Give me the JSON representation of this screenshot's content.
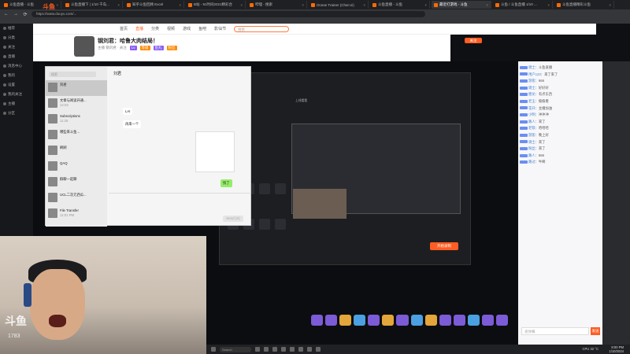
{
  "browser": {
    "tabs": [
      {
        "title": "斗鱼直播 - 斗鱼"
      },
      {
        "title": "斗鱼直播下 | 1/10 千岛..."
      },
      {
        "title": "知乎斗鱼回顾 Excel"
      },
      {
        "title": "B站 - 91时间2021精彩合"
      },
      {
        "title": "哔哩 - 搜索"
      },
      {
        "title": "Ocean Trainer (Chat Ui)"
      },
      {
        "title": "斗鱼直播 - 斗鱼"
      },
      {
        "title": "最近打游戏 - 斗鱼"
      },
      {
        "title": "斗鱼 / 斗鱼直播 1/10 ..."
      },
      {
        "title": "斗鱼直播精彩斗鱼"
      }
    ],
    "url": "https://www.douyu.com/...",
    "nav_back": "←",
    "nav_forward": "→",
    "nav_reload": "⟳"
  },
  "left_nav": {
    "items": [
      "推荐",
      "分类",
      "关注",
      "直播",
      "消息中心",
      "我的",
      "设置",
      "我的关注",
      "主播",
      "分区"
    ]
  },
  "site": {
    "logo": "斗鱼",
    "nav_links": [
      "首页",
      "直播",
      "分类",
      "视频",
      "游戏",
      "鱼吧",
      "影仙节"
    ],
    "search_placeholder": "搜索",
    "nav_highlight_index": 1
  },
  "room": {
    "title": "钢刘君：哈鲁大肉结局！",
    "host_line": "主播 钢刘君 · 关注",
    "badges": [
      "Lv",
      "等级",
      "鱼丸",
      "粉丝"
    ],
    "follow_label": "关注"
  },
  "wechat": {
    "search_placeholder": "搜索",
    "chat_title": "刘君",
    "conversations": [
      {
        "name": "刘君",
        "preview": "",
        "time": ""
      },
      {
        "name": "文章与阅读开通...",
        "preview": "",
        "time": "12:03"
      },
      {
        "name": "Subscriptions",
        "preview": "",
        "time": "11:25"
      },
      {
        "name": "哪些来斗鱼...",
        "preview": "",
        "time": ""
      },
      {
        "name": "刷刷",
        "preview": "",
        "time": ""
      },
      {
        "name": "QAQ",
        "preview": "",
        "time": ""
      },
      {
        "name": "群聊一起聊",
        "preview": "",
        "time": ""
      },
      {
        "name": "UCL二次元西瓜...",
        "preview": "",
        "time": ""
      },
      {
        "name": "File Transfer",
        "preview": "",
        "time": "11:01 PM"
      }
    ],
    "messages": [
      {
        "text": "LAI",
        "me": false
      },
      {
        "text": "再来一个",
        "me": false
      },
      {
        "text": "快了",
        "me": true
      }
    ],
    "send_label": "Send (S)"
  },
  "obs": {
    "record_label": "开始录制",
    "live_label": "上线看看"
  },
  "chat": {
    "messages": [
      {
        "user": "骑士",
        "text": "斗鱼直播"
      },
      {
        "user": "用户123",
        "text": "来了来了"
      },
      {
        "user": "游客",
        "text": "666"
      },
      {
        "user": "骑士",
        "text": "好好好"
      },
      {
        "user": "肥龙",
        "text": "有点东西"
      },
      {
        "user": "老王",
        "text": "偷偷看"
      },
      {
        "user": "花开",
        "text": "主播加油"
      },
      {
        "user": "小明",
        "text": "冲冲冲"
      },
      {
        "user": "路人",
        "text": "来了"
      },
      {
        "user": "老铁",
        "text": "哈哈哈"
      },
      {
        "user": "游客",
        "text": "晚上好"
      },
      {
        "user": "骑士",
        "text": "来了"
      },
      {
        "user": "粉丝",
        "text": "来了"
      },
      {
        "user": "路人",
        "text": "666"
      },
      {
        "user": "路过",
        "text": "牛啊"
      }
    ],
    "input_placeholder": "发弹幕",
    "send_label": "发送"
  },
  "webcam": {
    "watermark": "斗鱼",
    "room_id": "1783"
  },
  "taskbar": {
    "search_placeholder": "Search",
    "cpu": "CPU  32 °C",
    "time": "8:00 PM",
    "date": "1/10/2024"
  },
  "colors": {
    "brand": "#ff5d23",
    "accent": "#8a5cf6"
  }
}
